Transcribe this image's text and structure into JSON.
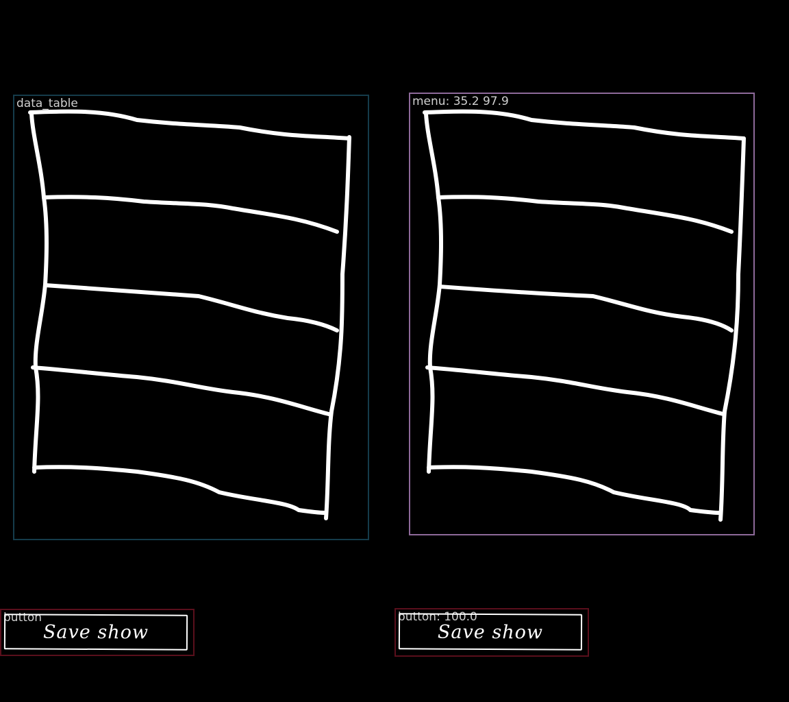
{
  "regions": {
    "table_left": {
      "label": "data_table"
    },
    "menu_right": {
      "label": "menu: 35.2 97.9"
    },
    "button_left": {
      "label": "button",
      "text": "Save show"
    },
    "button_right": {
      "label": "button: 100.0",
      "text": "Save show"
    }
  },
  "colors": {
    "background": "#000000",
    "sketch_stroke": "#ffffff",
    "label_text": "#d0d0d0",
    "table_box": "#153c4b",
    "menu_box": "#8e6a9a",
    "button_box": "#5a0f1c"
  }
}
